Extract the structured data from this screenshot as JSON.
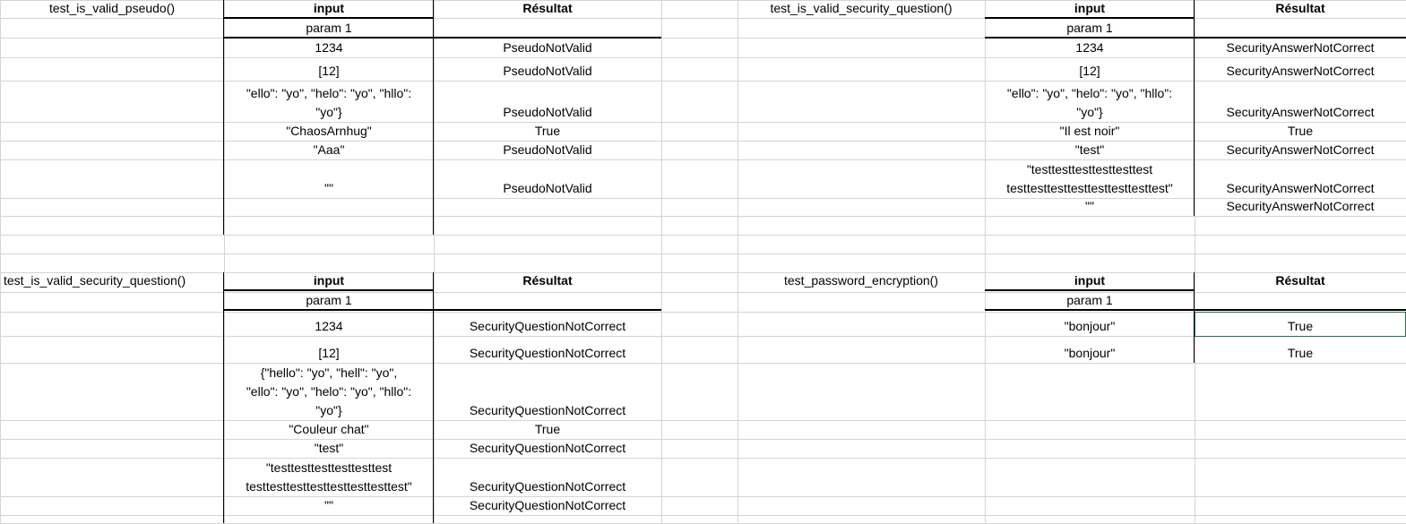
{
  "headers": {
    "input": "input",
    "result": "Résultat",
    "param": "param 1"
  },
  "tables": [
    {
      "title": "test_is_valid_pseudo()",
      "rows": [
        {
          "input": [
            "1234"
          ],
          "result": "PseudoNotValid"
        },
        {
          "input": [
            "[12]"
          ],
          "result": "PseudoNotValid"
        },
        {
          "input": [
            "\"ello\": \"yo\", \"helo\": \"yo\", \"hllo\":",
            "\"yo\"}"
          ],
          "result": "PseudoNotValid"
        },
        {
          "input": [
            "\"ChaosArnhug\""
          ],
          "result": "True"
        },
        {
          "input": [
            "\"Aaa\""
          ],
          "result": "PseudoNotValid"
        },
        {
          "input": [
            "\"\""
          ],
          "result": "PseudoNotValid"
        }
      ]
    },
    {
      "title": "test_is_valid_security_question()",
      "rows": [
        {
          "input": [
            "1234"
          ],
          "result": "SecurityAnswerNotCorrect"
        },
        {
          "input": [
            "[12]"
          ],
          "result": "SecurityAnswerNotCorrect"
        },
        {
          "input": [
            "\"ello\": \"yo\", \"helo\": \"yo\", \"hllo\":",
            "\"yo\"}"
          ],
          "result": "SecurityAnswerNotCorrect"
        },
        {
          "input": [
            "\"Il est noir\""
          ],
          "result": "True"
        },
        {
          "input": [
            "\"test\""
          ],
          "result": "SecurityAnswerNotCorrect"
        },
        {
          "input": [
            "\"testtesttesttesttesttest",
            "testtesttesttesttesttesttesttest\""
          ],
          "result": "SecurityAnswerNotCorrect"
        },
        {
          "input": [
            "\"\""
          ],
          "result": "SecurityAnswerNotCorrect"
        }
      ]
    },
    {
      "title": "test_is_valid_security_question()",
      "rows": [
        {
          "input": [
            "1234"
          ],
          "result": "SecurityQuestionNotCorrect"
        },
        {
          "input": [
            "[12]"
          ],
          "result": "SecurityQuestionNotCorrect"
        },
        {
          "input": [
            "{\"hello\": \"yo\", \"hell\": \"yo\",",
            "\"ello\": \"yo\", \"helo\": \"yo\", \"hllo\":",
            "\"yo\"}"
          ],
          "result": "SecurityQuestionNotCorrect"
        },
        {
          "input": [
            "\"Couleur chat\""
          ],
          "result": "True"
        },
        {
          "input": [
            "\"test\""
          ],
          "result": "SecurityQuestionNotCorrect"
        },
        {
          "input": [
            "\"testtesttesttesttesttest",
            "testtesttesttesttesttesttesttest\""
          ],
          "result": "SecurityQuestionNotCorrect"
        },
        {
          "input": [
            "\"\""
          ],
          "result": "SecurityQuestionNotCorrect"
        }
      ]
    },
    {
      "title": "test_password_encryption()",
      "rows": [
        {
          "input": [
            "\"bonjour\""
          ],
          "result": "True"
        },
        {
          "input": [
            "\"bonjour\""
          ],
          "result": "True"
        }
      ]
    }
  ]
}
